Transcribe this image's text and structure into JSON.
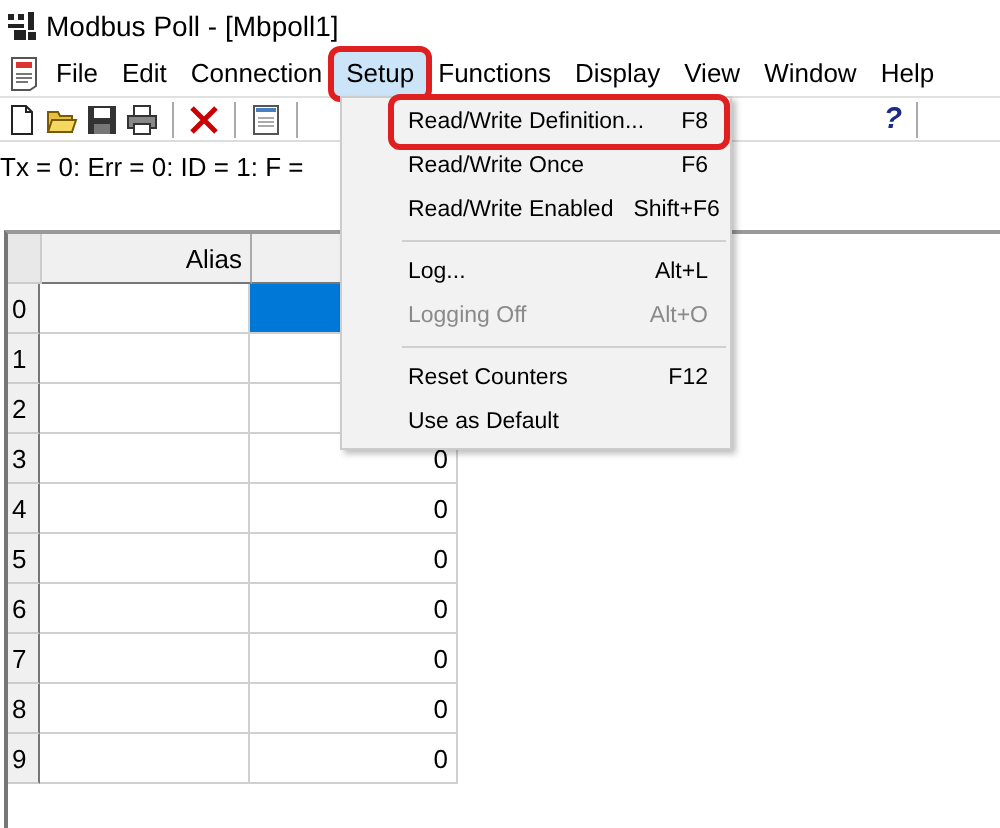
{
  "window": {
    "title": "Modbus Poll - [Mbpoll1]"
  },
  "menu_bar": [
    {
      "label": "File",
      "selected": false,
      "annotated": false
    },
    {
      "label": "Edit",
      "selected": false,
      "annotated": false
    },
    {
      "label": "Connection",
      "selected": false,
      "annotated": false
    },
    {
      "label": "Setup",
      "selected": true,
      "annotated": true
    },
    {
      "label": "Functions",
      "selected": false,
      "annotated": false
    },
    {
      "label": "Display",
      "selected": false,
      "annotated": false
    },
    {
      "label": "View",
      "selected": false,
      "annotated": false
    },
    {
      "label": "Window",
      "selected": false,
      "annotated": false
    },
    {
      "label": "Help",
      "selected": false,
      "annotated": false
    }
  ],
  "toolbar": [
    {
      "kind": "new"
    },
    {
      "kind": "open"
    },
    {
      "kind": "save"
    },
    {
      "kind": "print"
    },
    {
      "kind": "separator"
    },
    {
      "kind": "delete"
    },
    {
      "kind": "separator"
    },
    {
      "kind": "window"
    },
    {
      "kind": "separator"
    }
  ],
  "toolbar_right": [
    {
      "kind": "help",
      "glyph": "?"
    },
    {
      "kind": "separator"
    }
  ],
  "status_text": "Tx = 0: Err = 0: ID = 1: F =",
  "setup_menu": [
    {
      "kind": "item",
      "label": "Read/Write Definition...",
      "shortcut": "F8",
      "disabled": false,
      "annotated": true
    },
    {
      "kind": "item",
      "label": "Read/Write Once",
      "shortcut": "F6",
      "disabled": false,
      "annotated": false
    },
    {
      "kind": "item",
      "label": "Read/Write Enabled",
      "shortcut": "Shift+F6",
      "disabled": false,
      "annotated": false
    },
    {
      "kind": "separator"
    },
    {
      "kind": "item",
      "label": "Log...",
      "shortcut": "Alt+L",
      "disabled": false,
      "annotated": false
    },
    {
      "kind": "item",
      "label": "Logging Off",
      "shortcut": "Alt+O",
      "disabled": true,
      "annotated": false
    },
    {
      "kind": "separator"
    },
    {
      "kind": "item",
      "label": "Reset Counters",
      "shortcut": "F12",
      "disabled": false,
      "annotated": false
    },
    {
      "kind": "item",
      "label": "Use as Default",
      "disabled": false,
      "annotated": false
    }
  ],
  "table": {
    "columns": [
      "Alias"
    ],
    "rows": [
      {
        "index": "0",
        "selected": true
      },
      {
        "index": "1",
        "selected": false
      },
      {
        "index": "2",
        "selected": false
      },
      {
        "index": "3",
        "value": "0",
        "selected": false
      },
      {
        "index": "4",
        "value": "0",
        "selected": false
      },
      {
        "index": "5",
        "value": "0",
        "selected": false
      },
      {
        "index": "6",
        "value": "0",
        "selected": false
      },
      {
        "index": "7",
        "value": "0",
        "selected": false
      },
      {
        "index": "8",
        "value": "0",
        "selected": false
      },
      {
        "index": "9",
        "value": "0",
        "selected": false
      }
    ]
  }
}
